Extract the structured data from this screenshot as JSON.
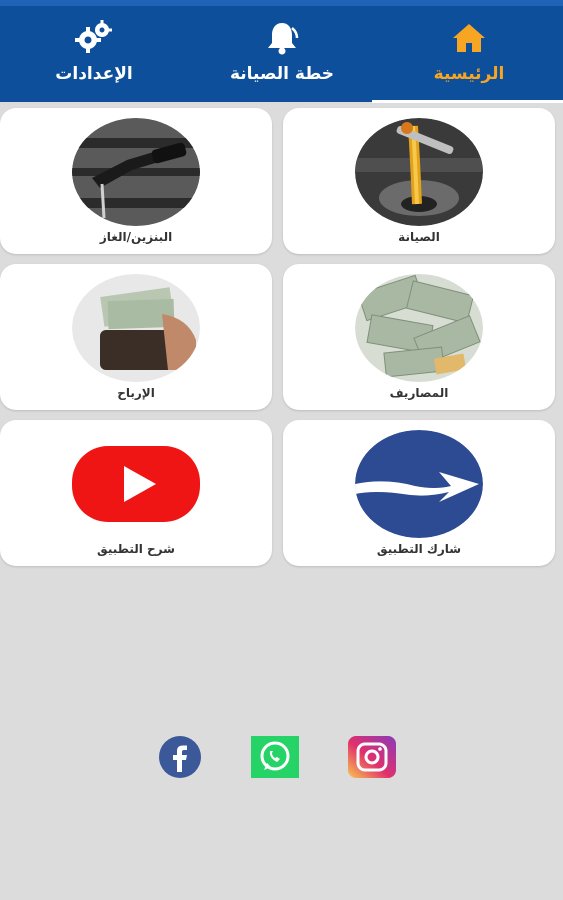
{
  "nav": {
    "tabs": [
      {
        "label": "الرئيسية",
        "icon": "home-icon",
        "active": true
      },
      {
        "label": "خطة الصيانة",
        "icon": "bell-icon",
        "active": false
      },
      {
        "label": "الإعدادات",
        "icon": "gears-icon",
        "active": false
      }
    ]
  },
  "cards": [
    {
      "label": "الصيانة",
      "icon": "oil-change-photo"
    },
    {
      "label": "البنزين/الغاز",
      "icon": "fuel-nozzle-photo"
    },
    {
      "label": "المصاريف",
      "icon": "money-bills-photo"
    },
    {
      "label": "الإرباح",
      "icon": "wallet-cash-photo"
    },
    {
      "label": "شارك التطبيق",
      "icon": "share-arrow-icon"
    },
    {
      "label": "شرح التطبيق",
      "icon": "youtube-play-icon"
    }
  ],
  "social": [
    {
      "name": "facebook-icon"
    },
    {
      "name": "whatsapp-icon"
    },
    {
      "name": "instagram-icon"
    }
  ],
  "colors": {
    "navbar": "#0e4f9b",
    "active_tab": "#f6a623",
    "background": "#dcdcdc"
  }
}
